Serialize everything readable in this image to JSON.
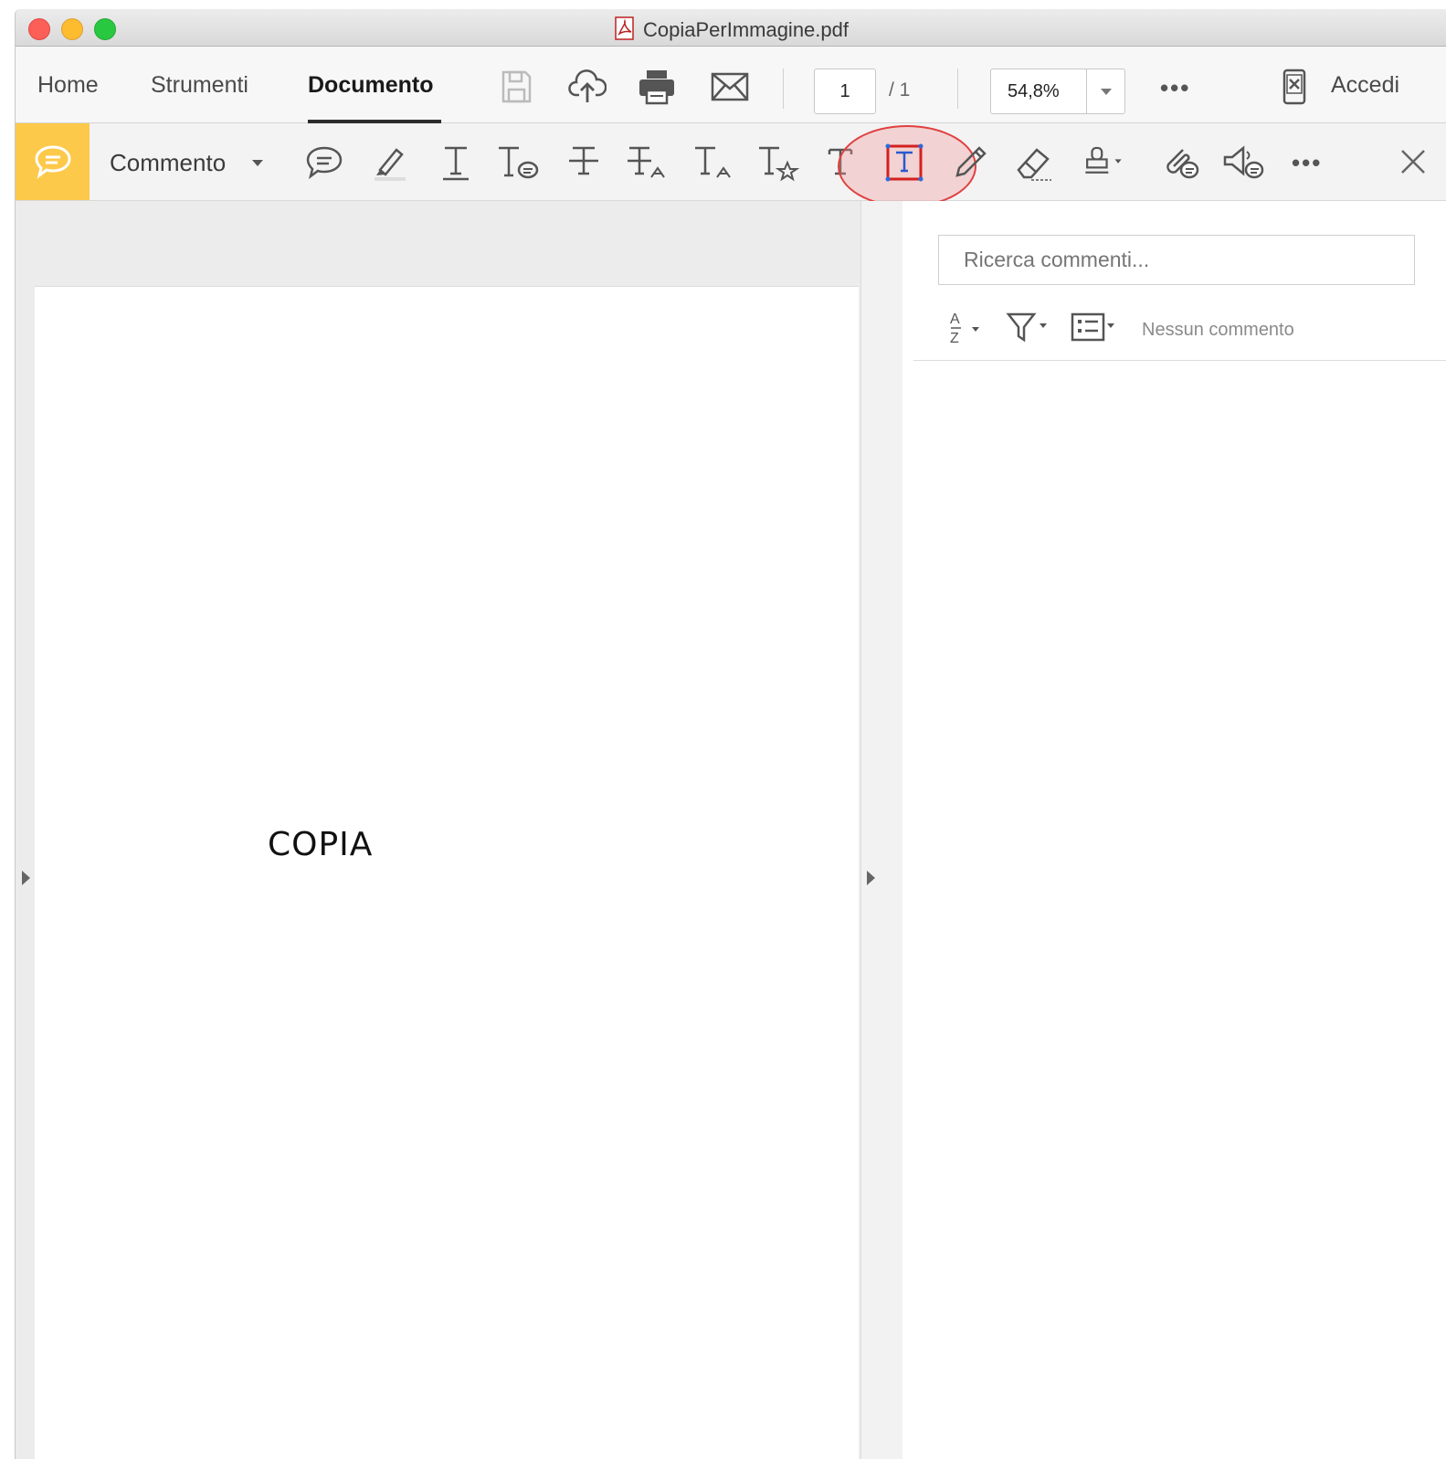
{
  "window": {
    "title": "CopiaPerImmagine.pdf"
  },
  "toolbar": {
    "tabs": [
      {
        "label": "Home"
      },
      {
        "label": "Strumenti"
      },
      {
        "label": "Documento"
      }
    ],
    "icons": [
      "save-icon",
      "cloud-upload-icon",
      "print-icon",
      "email-icon"
    ],
    "page_current": "1",
    "page_total": "/ 1",
    "zoom": "54,8%",
    "more_label": "•••",
    "signin_label": "Accedi"
  },
  "comment_toolbar": {
    "label": "Commento",
    "more_label": "•••",
    "tools": [
      "sticky-note-icon",
      "highlight-icon",
      "underline-text-icon",
      "text-comment-icon",
      "strikethrough-icon",
      "replace-text-icon",
      "insert-text-icon",
      "add-note-to-text-icon",
      "typewriter-icon",
      "textbox-icon",
      "pencil-icon",
      "eraser-icon",
      "stamp-icon",
      "attach-file-icon",
      "record-audio-icon"
    ],
    "selected_tool": "textbox-icon"
  },
  "document": {
    "page_text": "COPIA"
  },
  "comments_panel": {
    "search_placeholder": "Ricerca commenti...",
    "status": "Nessun commento"
  },
  "colors": {
    "comment_accent": "#fdc94a",
    "highlight_ring": "#e04040"
  }
}
